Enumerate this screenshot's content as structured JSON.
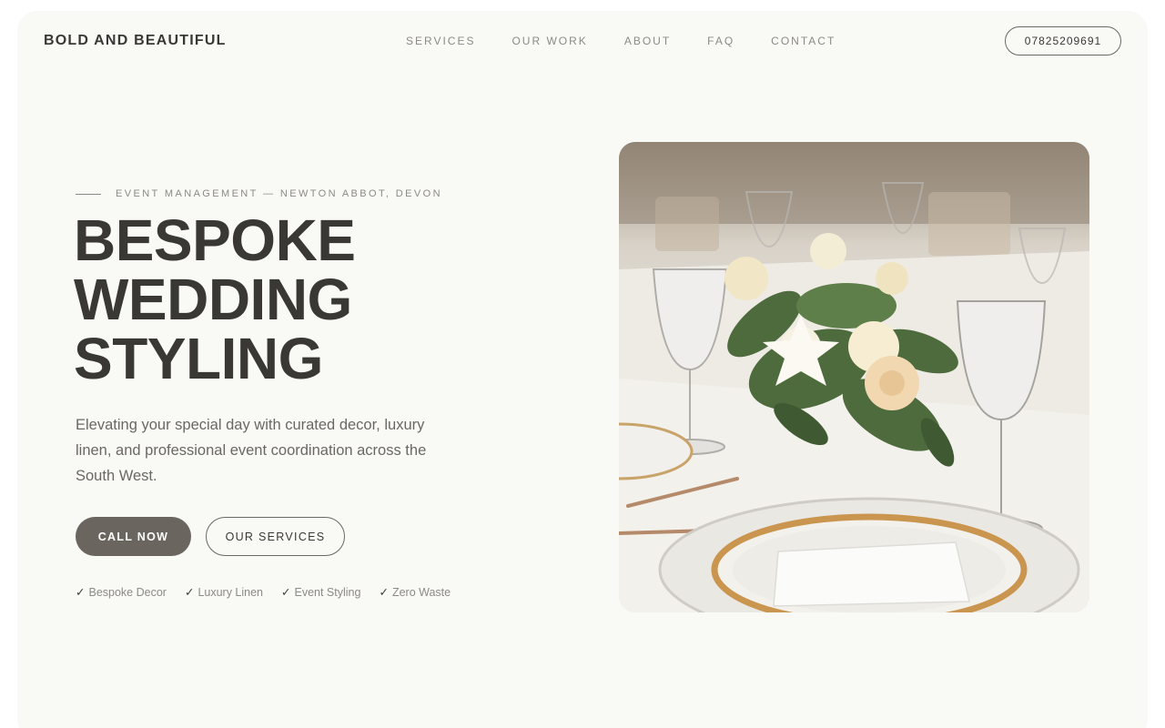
{
  "header": {
    "brand": "BOLD AND BEAUTIFUL",
    "nav": [
      "SERVICES",
      "OUR WORK",
      "ABOUT",
      "FAQ",
      "CONTACT"
    ],
    "phone": "07825209691"
  },
  "hero": {
    "eyebrow": "EVENT MANAGEMENT — NEWTON ABBOT, DEVON",
    "headline": [
      "BESPOKE",
      "WEDDING",
      "STYLING"
    ],
    "lede": "Elevating your special day with curated decor, luxury linen, and professional event coordination across the South West.",
    "primary_cta": "CALL NOW",
    "secondary_cta": "OUR SERVICES",
    "features": [
      "Bespoke Decor",
      "Luxury Linen",
      "Event Styling",
      "Zero Waste"
    ],
    "check_glyph": "✓"
  },
  "colors": {
    "background": "#f9f9f6",
    "text": "#3a3835",
    "muted": "#8c8a86",
    "button": "#6b6560"
  }
}
